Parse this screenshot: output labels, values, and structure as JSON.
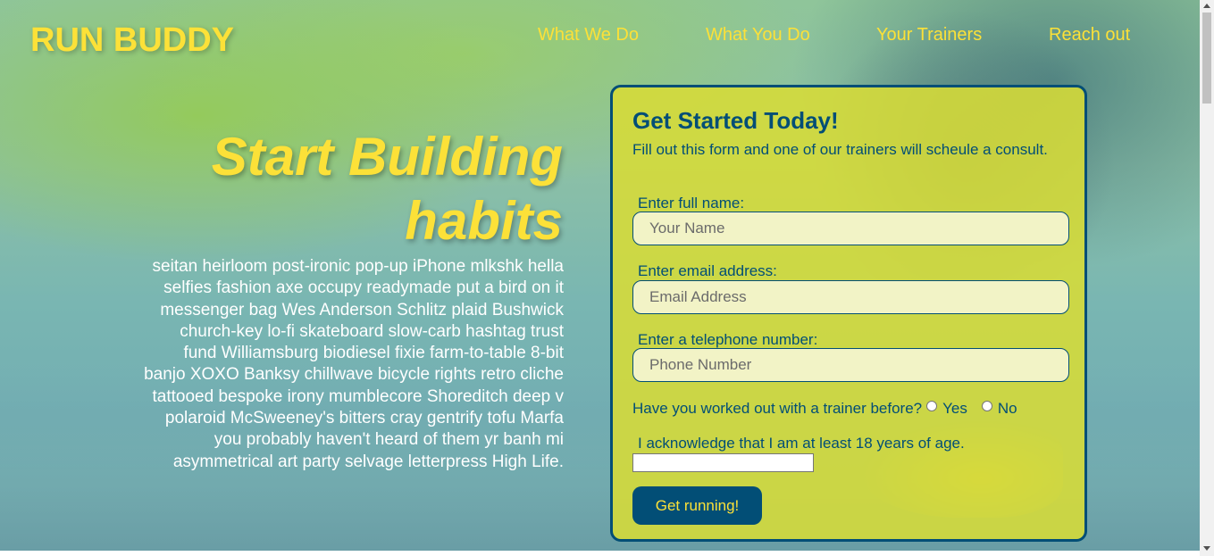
{
  "header": {
    "brand": "RUN BUDDY",
    "nav": [
      "What We Do",
      "What You Do",
      "Your Trainers",
      "Reach out"
    ]
  },
  "hero": {
    "title": "Start Building habits",
    "text": "seitan heirloom post-ironic pop-up iPhone mlkshk hella selfies fashion axe occupy readymade put a bird on it messenger bag Wes Anderson Schlitz plaid Bushwick church-key lo-fi skateboard slow-carb hashtag trust fund Williamsburg biodiesel fixie farm-to-table 8-bit banjo XOXO Banksy chillwave bicycle rights retro cliche tattooed bespoke irony mumblecore Shoreditch deep v polaroid McSweeney's bitters cray gentrify tofu Marfa you probably haven't heard of them yr banh mi asymmetrical art party selvage letterpress High Life."
  },
  "form": {
    "title": "Get Started Today!",
    "subtitle": "Fill out this form and one of our trainers will scheule a consult.",
    "name_label": "Enter full name:",
    "name_placeholder": "Your Name",
    "email_label": "Enter email address:",
    "email_placeholder": "Email Address",
    "phone_label": "Enter a telephone number:",
    "phone_placeholder": "Phone Number",
    "question": "Have you worked out with a trainer before?",
    "option_yes": "Yes",
    "option_no": "No",
    "ack_label": "I acknowledge that I am at least 18 years of age.",
    "submit": "Get running!"
  },
  "colors": {
    "brand_yellow": "#fce138",
    "brand_blue": "#024e76"
  }
}
